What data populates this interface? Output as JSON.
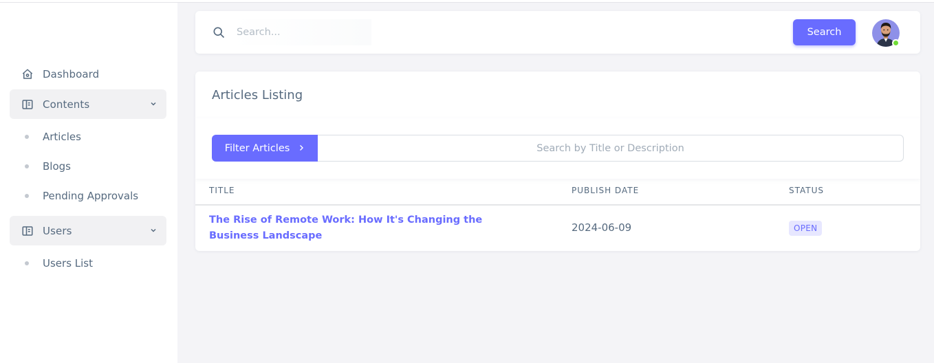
{
  "sidebar": {
    "items": [
      {
        "label": "Dashboard",
        "icon": "home-icon"
      },
      {
        "label": "Contents",
        "icon": "book-icon",
        "expanded": true,
        "children": [
          {
            "label": "Articles"
          },
          {
            "label": "Blogs"
          },
          {
            "label": "Pending Approvals"
          }
        ]
      },
      {
        "label": "Users",
        "icon": "book-icon",
        "expanded": true,
        "children": [
          {
            "label": "Users List"
          }
        ]
      }
    ]
  },
  "topbar": {
    "search_placeholder": "Search...",
    "search_button": "Search"
  },
  "colors": {
    "accent": "#696cff",
    "text": "#566a7f",
    "badge_bg": "#e7e7ff",
    "online": "#71dd37"
  },
  "card": {
    "title": "Articles Listing",
    "filter_button": "Filter Articles",
    "filter_placeholder": "Search by Title or Description",
    "columns": [
      "TITLE",
      "PUBLISH DATE",
      "STATUS"
    ],
    "rows": [
      {
        "title": "The Rise of Remote Work: How It's Changing the Business Landscape",
        "publish_date": "2024-06-09",
        "status": "OPEN"
      }
    ]
  }
}
